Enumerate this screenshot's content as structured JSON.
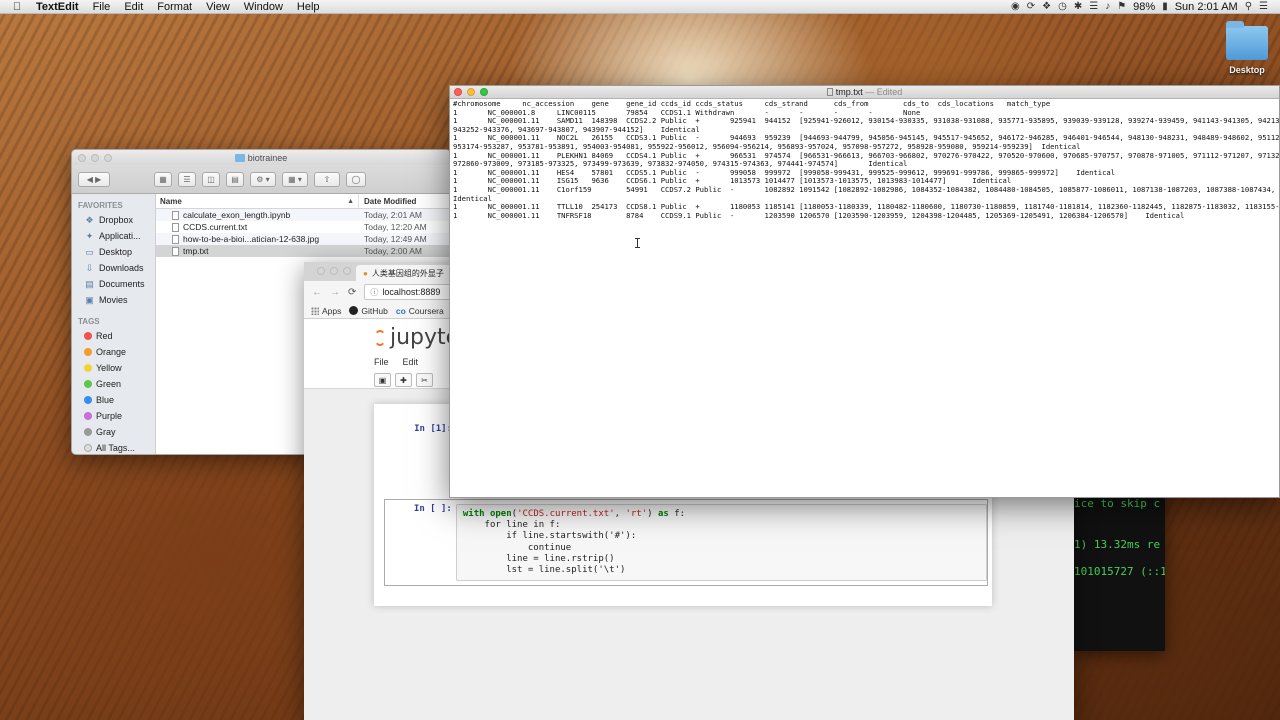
{
  "menubar": {
    "app_name": "TextEdit",
    "items": [
      "File",
      "Edit",
      "Format",
      "View",
      "Window",
      "Help"
    ],
    "battery": "98%",
    "clock": "Sun 2:01 AM"
  },
  "desktop": {
    "folder_label": "Desktop"
  },
  "finder": {
    "title": "biotrainee",
    "sidebar_favorites_heading": "FAVORITES",
    "favorites": [
      "Dropbox",
      "Applicati...",
      "Desktop",
      "Downloads",
      "Documents",
      "Movies"
    ],
    "tags_heading": "TAGS",
    "tags": [
      {
        "label": "Red",
        "color": "#f0524f"
      },
      {
        "label": "Orange",
        "color": "#f39c2d"
      },
      {
        "label": "Yellow",
        "color": "#f2d43a"
      },
      {
        "label": "Green",
        "color": "#5fc84a"
      },
      {
        "label": "Blue",
        "color": "#3a8ef0"
      },
      {
        "label": "Purple",
        "color": "#c86fd8"
      },
      {
        "label": "Gray",
        "color": "#9a9a9a"
      },
      {
        "label": "All Tags...",
        "color": "#dcdcdc"
      }
    ],
    "columns": {
      "name": "Name",
      "date": "Date Modified"
    },
    "files": [
      {
        "name": "calculate_exon_length.ipynb",
        "date": "Today, 2:01 AM"
      },
      {
        "name": "CCDS.current.txt",
        "date": "Today, 12:20 AM"
      },
      {
        "name": "how-to-be-a-bioi...atician-12-638.jpg",
        "date": "Today, 12:49 AM"
      },
      {
        "name": "tmp.txt",
        "date": "Today, 2:00 AM"
      }
    ]
  },
  "chrome": {
    "tab_title": "人类基因组的外显子",
    "url": "localhost:8889",
    "bookmarks": [
      "Apps",
      "GitHub",
      "Coursera"
    ]
  },
  "jupyter": {
    "logo_text": "jupyte",
    "menu": [
      "File",
      "Edit"
    ],
    "cell1_prompt": "In [1]:",
    "cell2_prompt": "In [ ]:",
    "code_lines": [
      "with open('CCDS.current.txt', 'rt') as f:",
      "    for line in f:",
      "        if line.startswith('#'):",
      "            continue",
      "        line = line.rstrip()",
      "        lst = line.split('\\t')"
    ]
  },
  "terminal": {
    "lines": [
      "ice to skip c",
      "1) 13.32ms re",
      "101015727 (::1"
    ]
  },
  "textedit": {
    "filename": "tmp.txt",
    "edited_suffix": "— Edited",
    "lines": [
      "#chromosome     nc_accession    gene    gene_id ccds_id ccds_status     cds_strand      cds_from        cds_to  cds_locations   match_type",
      "1       NC_000001.8     LINC00115       79854   CCDS1.1 Withdrawn       -       -       -       -       None",
      "1       NC_000001.11    SAMD11  148398  CCDS2.2 Public  +       925941  944152  [925941-926012, 930154-930335, 931038-931088, 935771-935895, 939039-939128, 939274-939459, 941143-941305, 942135-942250, 942",
      "943252-943376, 943697-943807, 943907-944152]    Identical",
      "1       NC_000001.11    NOC2L   26155   CCDS3.1 Public  -       944693  959239  [944693-944799, 945056-945145, 945517-945652, 946172-946285, 946401-946544, 948130-948231, 948489-948602, 951126-951237, 952",
      "953174-953287, 953781-953891, 954003-954081, 955922-956012, 956094-956214, 956893-957024, 957098-957272, 958928-959080, 959214-959239]  Identical",
      "1       NC_000001.11    PLEKHN1 84069   CCDS4.1 Public  +       966531  974574  [966531-966613, 966703-966802, 970276-970422, 970520-970600, 970685-970757, 970878-971005, 971112-971207, 971323-971403, 972",
      "972860-973009, 973185-973325, 973499-973639, 973832-974050, 974315-974363, 974441-974574]       Identical",
      "1       NC_000001.11    HES4    57801   CCDS5.1 Public  -       999058  999972  [999058-999431, 999525-999612, 999691-999786, 999865-999972]    Identical",
      "1       NC_000001.11    ISG15   9636    CCDS6.1 Public  +       1013573 1014477 [1013573-1013575, 1013983-1014477]      Identical",
      "1       NC_000001.11    C1orf159        54991   CCDS7.2 Public  -       1082892 1091542 [1082892-1082986, 1084352-1084382, 1084480-1084505, 1085877-1086011, 1087138-1087203, 1087388-1087434, 1091467-109",
      "Identical",
      "1       NC_000001.11    TTLL10  254173  CCDS8.1 Public  +       1180053 1185141 [1180053-1180339, 1180482-1180600, 1180730-1180859, 1181740-1181814, 1182360-1182445, 1182875-1183032, 1183155-1183213, 118",
      "1       NC_000001.11    TNFRSF18        8784    CCDS9.1 Public  -       1203590 1206570 [1203590-1203959, 1204398-1204485, 1205369-1205491, 1206384-1206570]    Identical"
    ]
  }
}
